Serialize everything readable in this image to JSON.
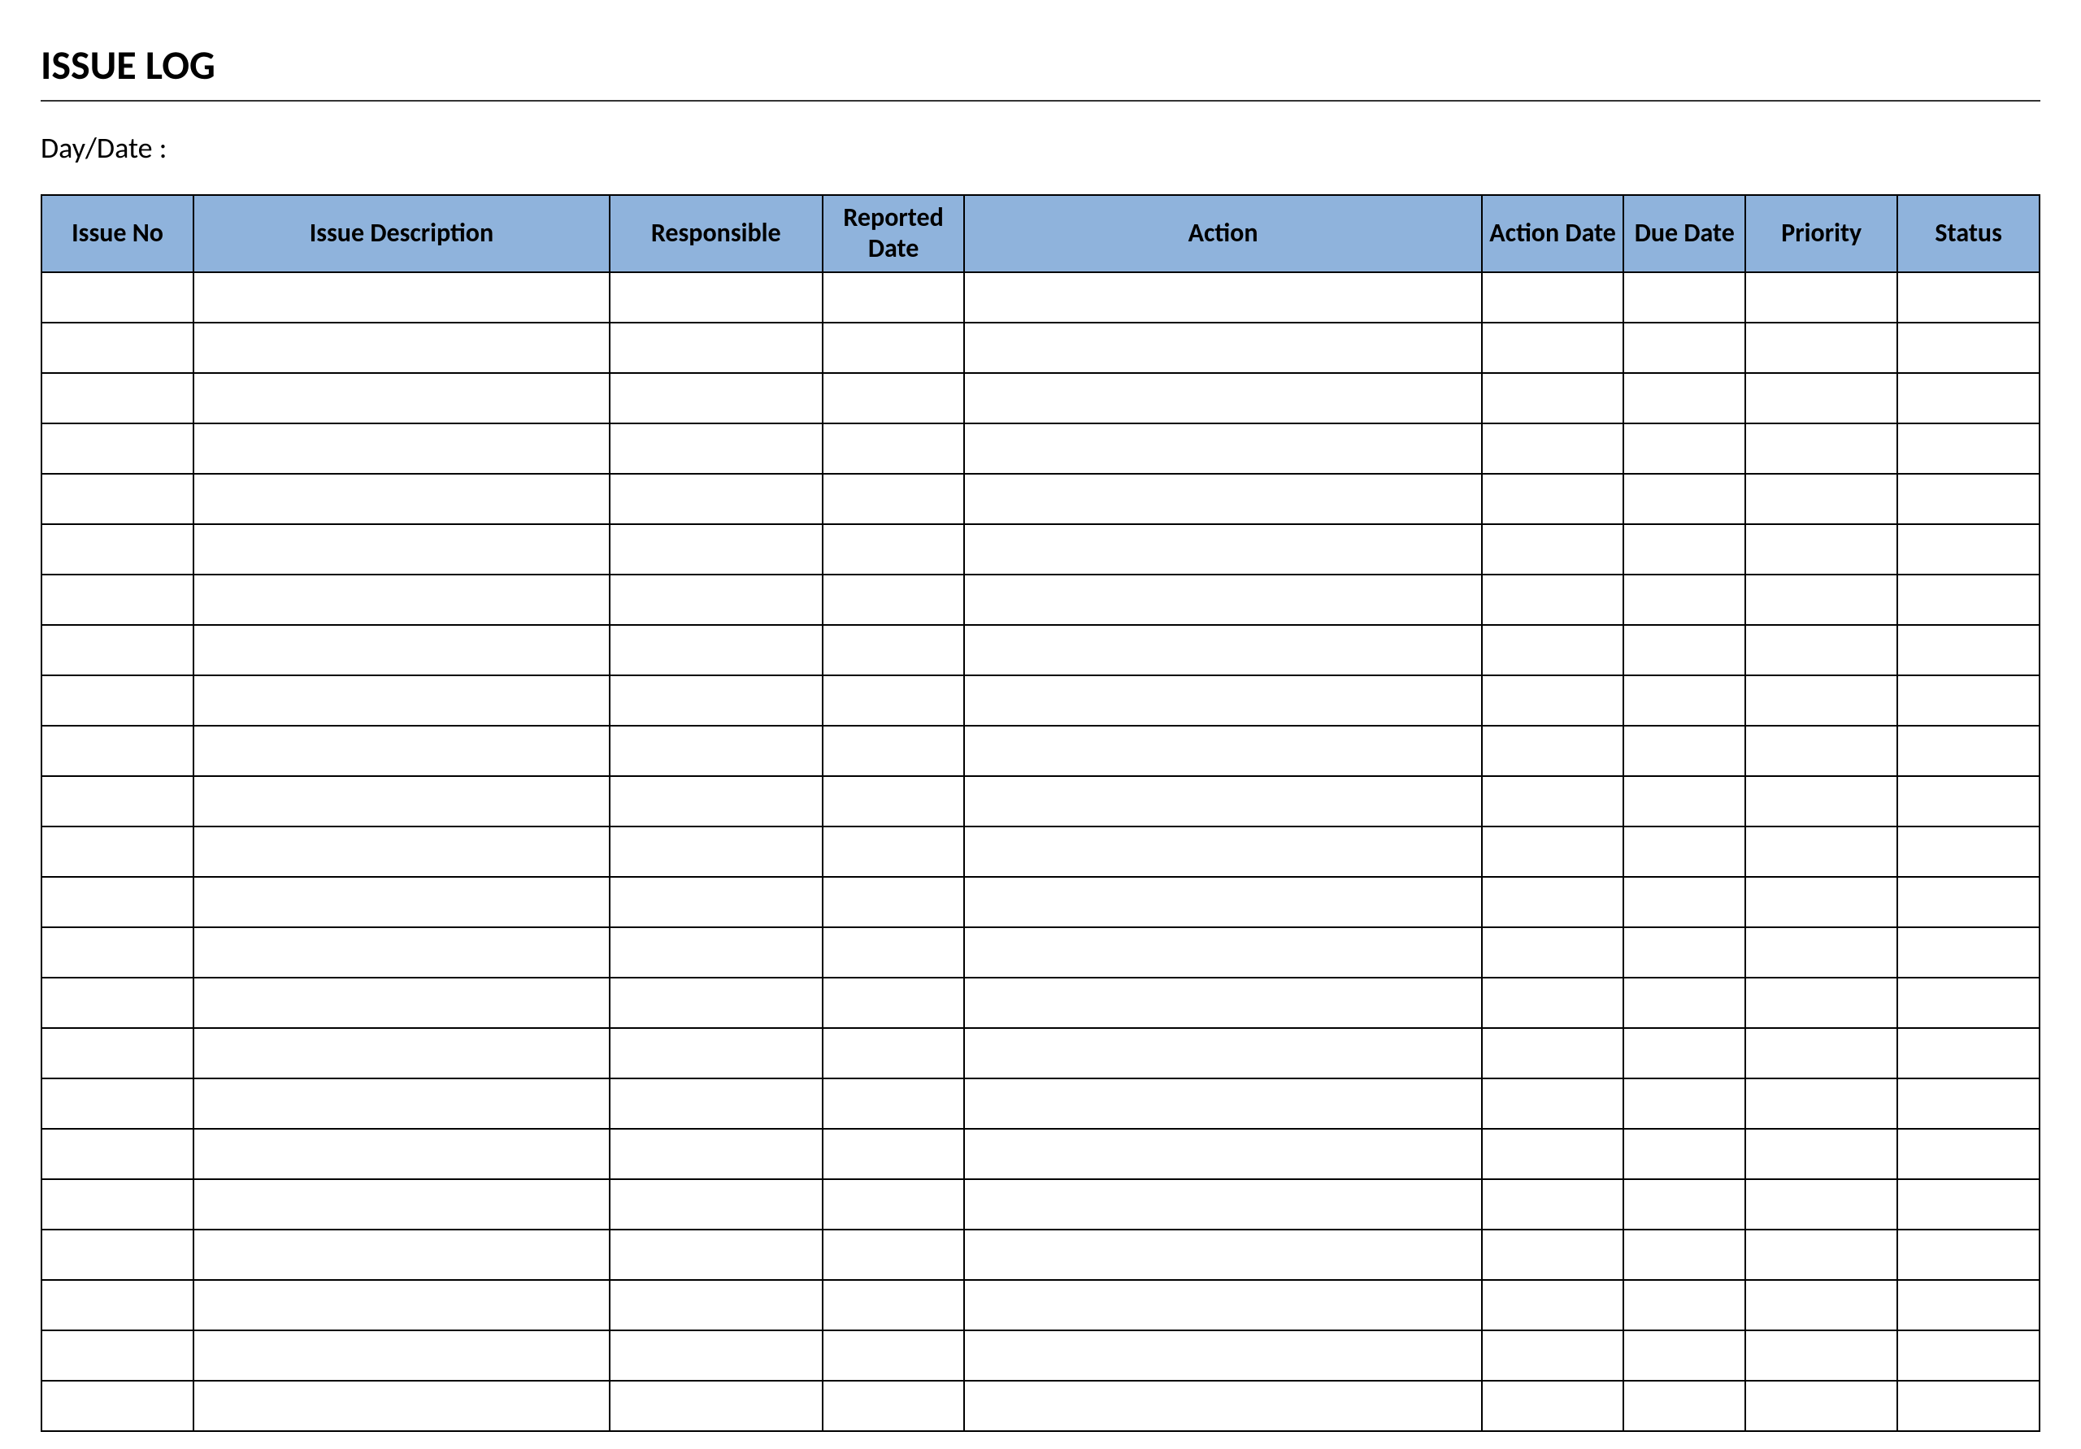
{
  "title": "ISSUE LOG",
  "dayDateLabel": "Day/Date :",
  "columns": [
    "Issue No",
    "Issue Description",
    "Responsible",
    "Reported Date",
    "Action",
    "Action Date",
    "Due Date",
    "Priority",
    "Status"
  ],
  "rows": [
    [
      "",
      "",
      "",
      "",
      "",
      "",
      "",
      "",
      ""
    ],
    [
      "",
      "",
      "",
      "",
      "",
      "",
      "",
      "",
      ""
    ],
    [
      "",
      "",
      "",
      "",
      "",
      "",
      "",
      "",
      ""
    ],
    [
      "",
      "",
      "",
      "",
      "",
      "",
      "",
      "",
      ""
    ],
    [
      "",
      "",
      "",
      "",
      "",
      "",
      "",
      "",
      ""
    ],
    [
      "",
      "",
      "",
      "",
      "",
      "",
      "",
      "",
      ""
    ],
    [
      "",
      "",
      "",
      "",
      "",
      "",
      "",
      "",
      ""
    ],
    [
      "",
      "",
      "",
      "",
      "",
      "",
      "",
      "",
      ""
    ],
    [
      "",
      "",
      "",
      "",
      "",
      "",
      "",
      "",
      ""
    ],
    [
      "",
      "",
      "",
      "",
      "",
      "",
      "",
      "",
      ""
    ],
    [
      "",
      "",
      "",
      "",
      "",
      "",
      "",
      "",
      ""
    ],
    [
      "",
      "",
      "",
      "",
      "",
      "",
      "",
      "",
      ""
    ],
    [
      "",
      "",
      "",
      "",
      "",
      "",
      "",
      "",
      ""
    ],
    [
      "",
      "",
      "",
      "",
      "",
      "",
      "",
      "",
      ""
    ],
    [
      "",
      "",
      "",
      "",
      "",
      "",
      "",
      "",
      ""
    ],
    [
      "",
      "",
      "",
      "",
      "",
      "",
      "",
      "",
      ""
    ],
    [
      "",
      "",
      "",
      "",
      "",
      "",
      "",
      "",
      ""
    ],
    [
      "",
      "",
      "",
      "",
      "",
      "",
      "",
      "",
      ""
    ],
    [
      "",
      "",
      "",
      "",
      "",
      "",
      "",
      "",
      ""
    ],
    [
      "",
      "",
      "",
      "",
      "",
      "",
      "",
      "",
      ""
    ],
    [
      "",
      "",
      "",
      "",
      "",
      "",
      "",
      "",
      ""
    ],
    [
      "",
      "",
      "",
      "",
      "",
      "",
      "",
      "",
      ""
    ],
    [
      "",
      "",
      "",
      "",
      "",
      "",
      "",
      "",
      ""
    ]
  ]
}
